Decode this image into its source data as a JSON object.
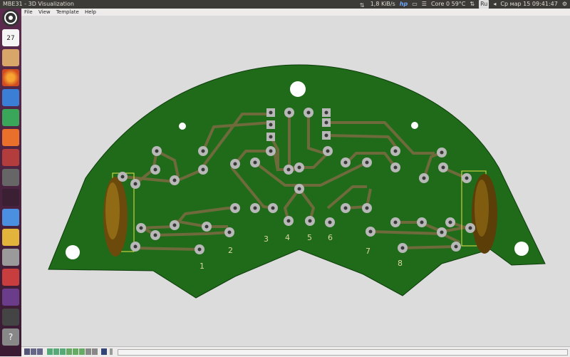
{
  "window": {
    "title": "MBE31 - 3D Visualization"
  },
  "topbar": {
    "net_speed": "1,8 KiB/s",
    "cpu": "Core 0 59°C",
    "keyboard_layout": "Ru",
    "datetime": "Ср мар 15 09:41:47"
  },
  "menu": [
    "File",
    "View",
    "Template",
    "Help"
  ],
  "launcher": {
    "items": [
      "ubuntu-logo-icon",
      "calendar-icon",
      "files-icon",
      "firefox-icon",
      "writer-icon",
      "calc-icon",
      "software-center-icon",
      "settings-icon",
      "calculator-icon",
      "terminal-icon",
      "dropbox-icon",
      "stack-icon",
      "apps-icon",
      "media-icon",
      "app-icon",
      "files2-icon",
      "help-icon"
    ],
    "calendar_day": "27"
  },
  "pcb": {
    "board_color": "#1f6b1a",
    "trace_color": "#6e6a3c",
    "pad_labels": [
      "1",
      "2",
      "3",
      "4",
      "5",
      "6",
      "7",
      "8"
    ]
  },
  "statusbar": {
    "buttons": [
      "view-all-icon",
      "zoom-in-icon",
      "zoom-out-icon",
      "grid-icon",
      "rotate-left-icon",
      "rotate-right-icon",
      "first-icon",
      "prev-icon",
      "play-icon",
      "next-icon",
      "last-icon",
      "render-icon",
      "scroll-handle"
    ]
  }
}
